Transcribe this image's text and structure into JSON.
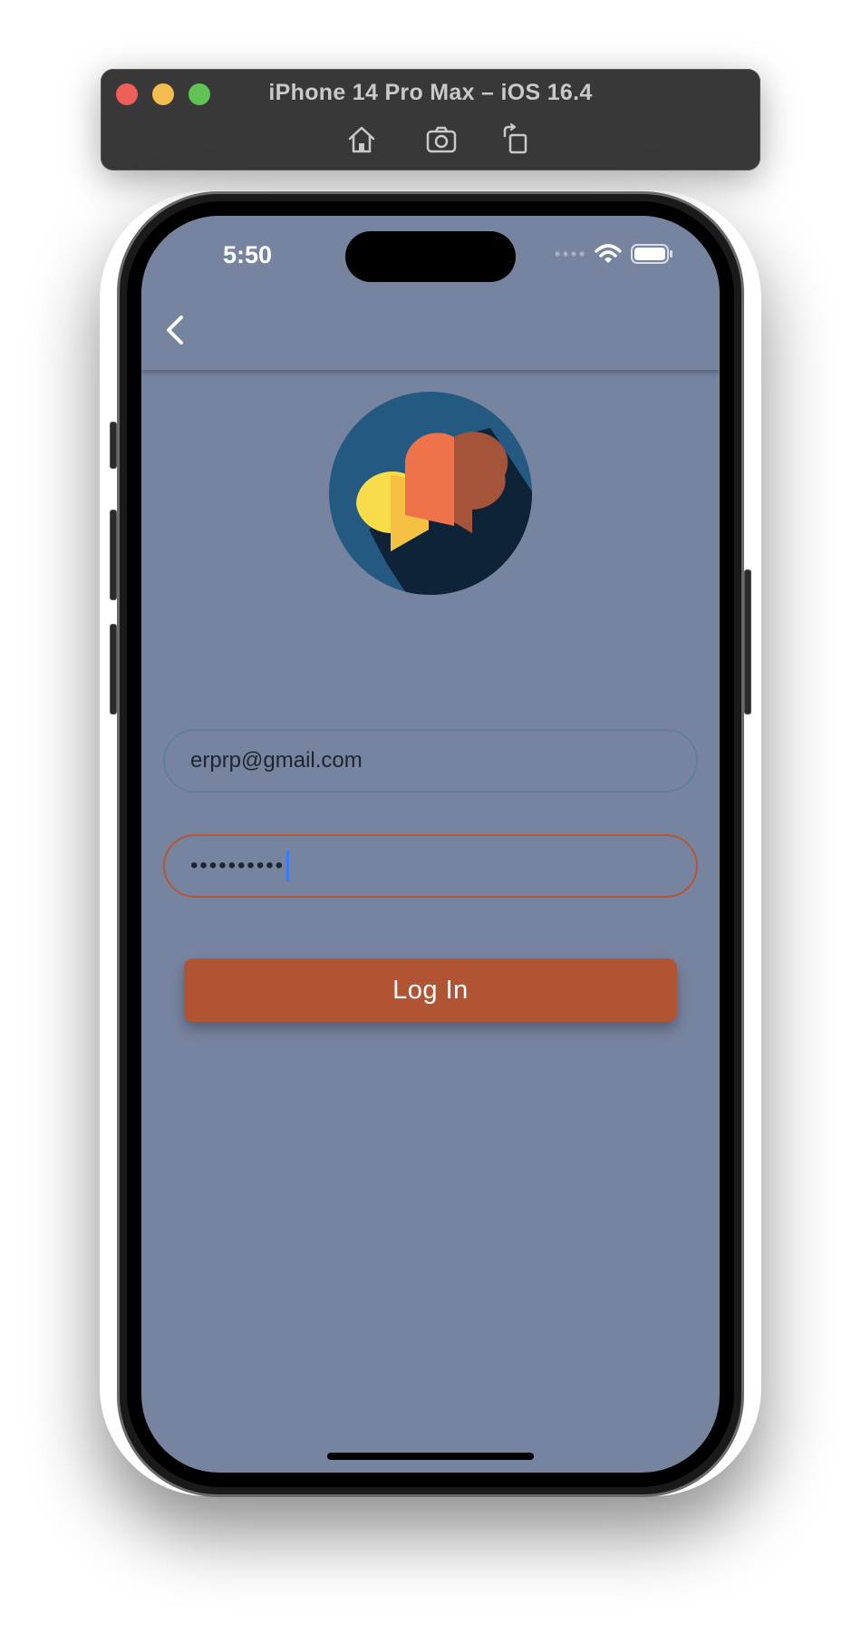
{
  "simulator": {
    "title": "iPhone 14 Pro Max – iOS 16.4",
    "tools": [
      "home-icon",
      "screenshot-icon",
      "rotate-icon"
    ]
  },
  "status_bar": {
    "time": "5:50"
  },
  "nav": {
    "back_icon": "chevron-left-icon"
  },
  "logo": {
    "icon": "chat-bubbles-logo"
  },
  "form": {
    "email_value": "erprp@gmail.com",
    "password_value": "••••••••••",
    "login_label": "Log In"
  },
  "colors": {
    "screen_bg": "#77849f",
    "email_border": "#5e7f97",
    "password_border": "#b5553a",
    "login_button": "#b15434",
    "logo_circle": "#245a82",
    "logo_shadow": "#0e2238",
    "bubble_yellow": "#f9dc4a",
    "bubble_orange": "#ee724a",
    "bubble_dark_orange": "#a5543a"
  }
}
